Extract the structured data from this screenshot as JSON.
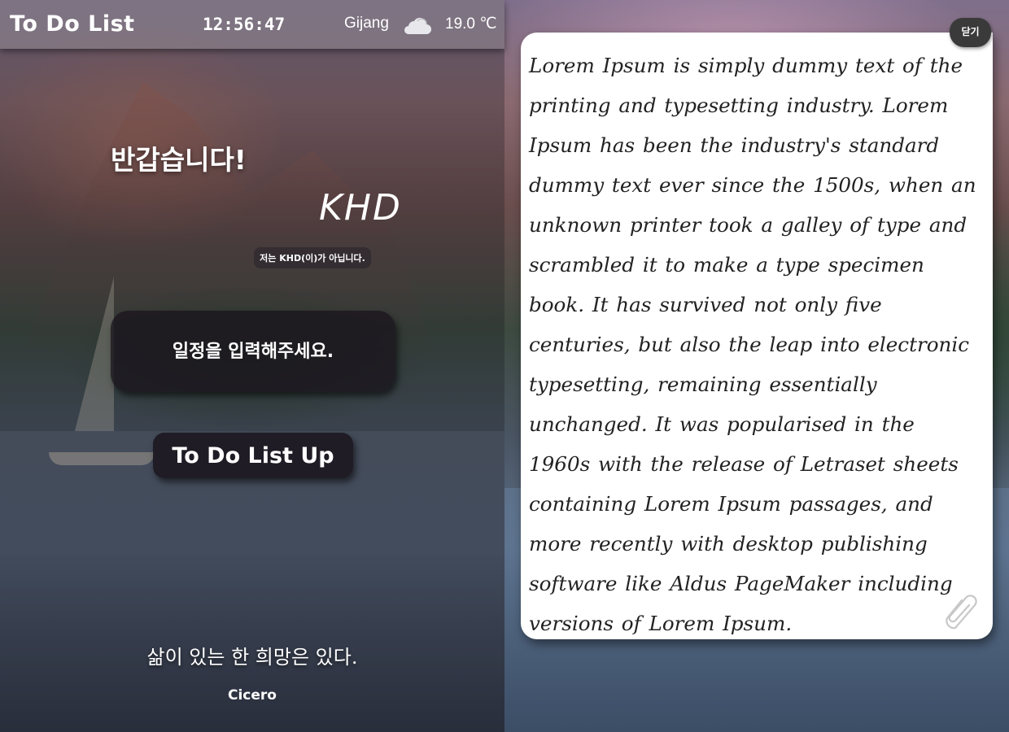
{
  "header": {
    "title": "To Do List",
    "clock": "12:56:47",
    "weather": {
      "city": "Gijang",
      "icon": "cloud-icon",
      "temperature": "19.0 ℃"
    }
  },
  "greeting": {
    "text": "반갑습니다!",
    "username": "KHD",
    "note": "저는 KHD(이)가 아닙니다."
  },
  "todo": {
    "input_placeholder": "일정을 입력해주세요.",
    "submit_label": "To Do List Up"
  },
  "quote": {
    "text": "삶이 있는 한 희망은 있다.",
    "author": "Cicero"
  },
  "memo": {
    "close_label": "닫기",
    "body": "Lorem Ipsum is simply dummy text of the printing and typesetting industry. Lorem Ipsum has been the industry's standard dummy text ever since the 1500s, when an unknown printer took a galley of type and scrambled it to make a type specimen book. It has survived not only five centuries, but also the leap into electronic typesetting, remaining essentially unchanged. It was popularised in the 1960s with the release of Letraset sheets containing Lorem Ipsum passages, and more recently with desktop publishing software like Aldus PageMaker including versions of Lorem Ipsum.",
    "attachment_icon": "paperclip-icon"
  },
  "colors": {
    "panel_dark": "#19141c",
    "memo_bg": "#ffffff",
    "close_button": "#3a3a3a"
  }
}
